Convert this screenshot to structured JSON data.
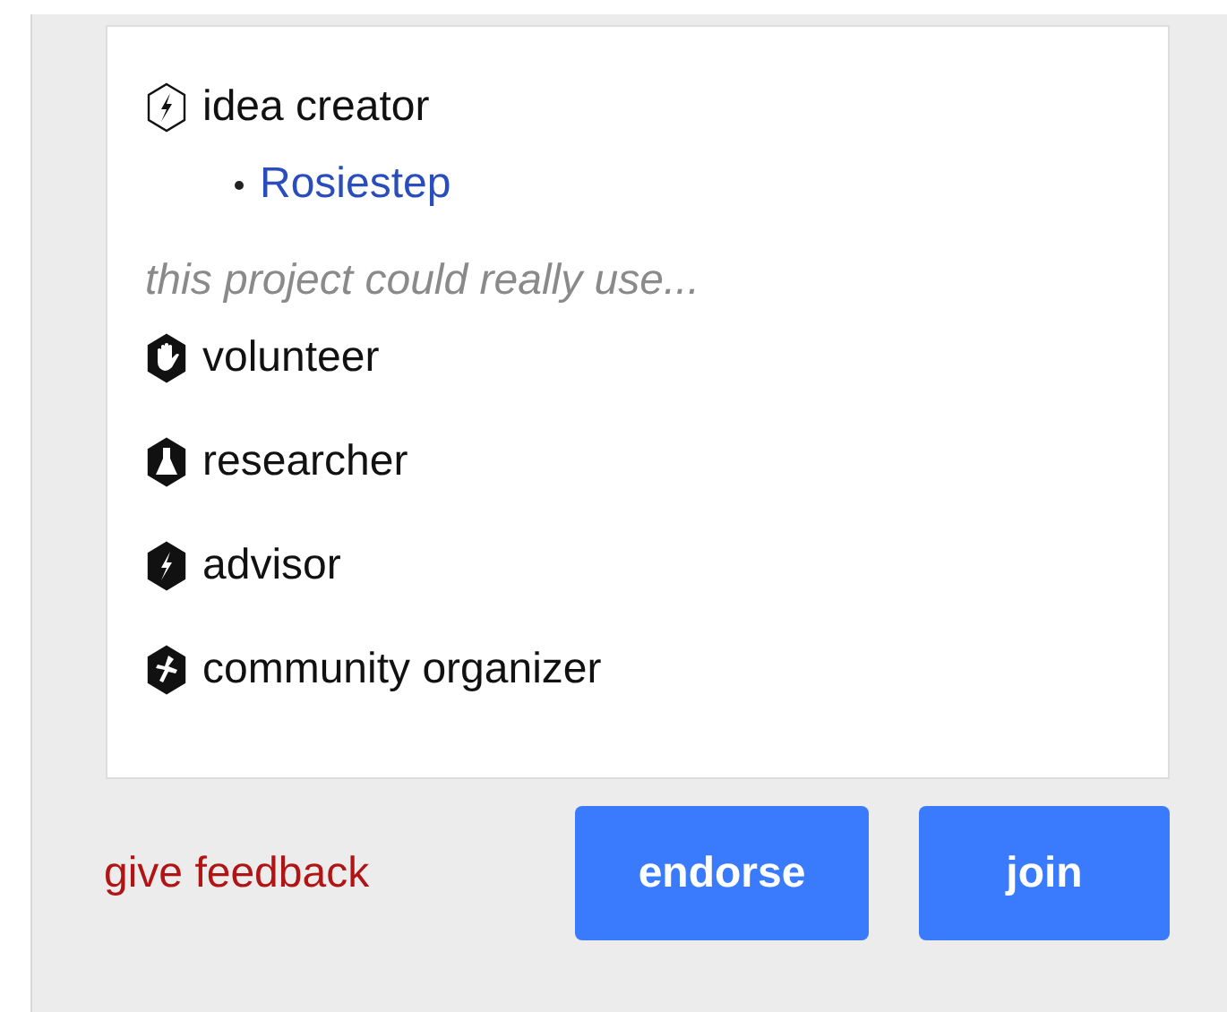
{
  "creator": {
    "heading": "idea creator",
    "people": [
      {
        "name": "Rosiestep"
      }
    ]
  },
  "needs": {
    "hint": "this project could really use...",
    "roles": [
      {
        "label": "volunteer"
      },
      {
        "label": "researcher"
      },
      {
        "label": "advisor"
      },
      {
        "label": "community organizer"
      }
    ]
  },
  "footer": {
    "feedback_link": "give feedback",
    "buttons": [
      "endorse",
      "join"
    ]
  }
}
